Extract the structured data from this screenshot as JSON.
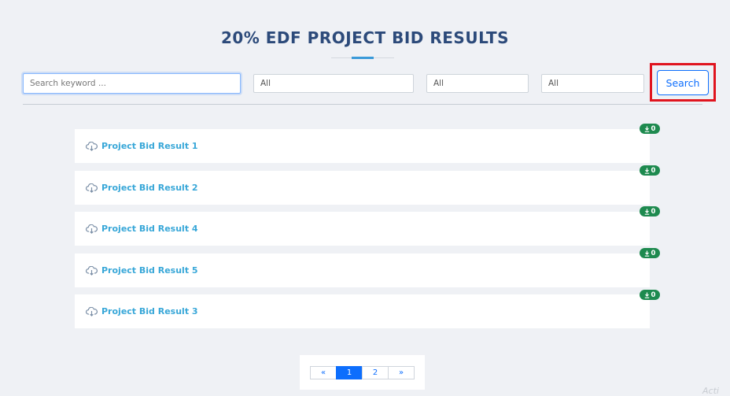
{
  "page": {
    "title": "20% EDF PROJECT BID RESULTS"
  },
  "filters": {
    "search_placeholder": "Search keyword ...",
    "filter_1_value": "All",
    "filter_2_value": "All",
    "filter_3_value": "All",
    "search_button_label": "Search"
  },
  "results": [
    {
      "label": "Project Bid Result 1",
      "downloads": "0"
    },
    {
      "label": "Project Bid Result 2",
      "downloads": "0"
    },
    {
      "label": "Project Bid Result 4",
      "downloads": "0"
    },
    {
      "label": "Project Bid Result 5",
      "downloads": "0"
    },
    {
      "label": "Project Bid Result 3",
      "downloads": "0"
    }
  ],
  "pagination": {
    "prev": "«",
    "pages": [
      "1",
      "2"
    ],
    "next": "»",
    "current": "1"
  },
  "watermark": "Acti",
  "colors": {
    "accent": "#0d6efd",
    "title": "#2c4a7a",
    "link": "#38a7d8",
    "badge": "#1e8a4f",
    "highlight": "#e0141e"
  },
  "icons": {
    "result": "cloud-download-icon",
    "badge": "download-icon"
  }
}
